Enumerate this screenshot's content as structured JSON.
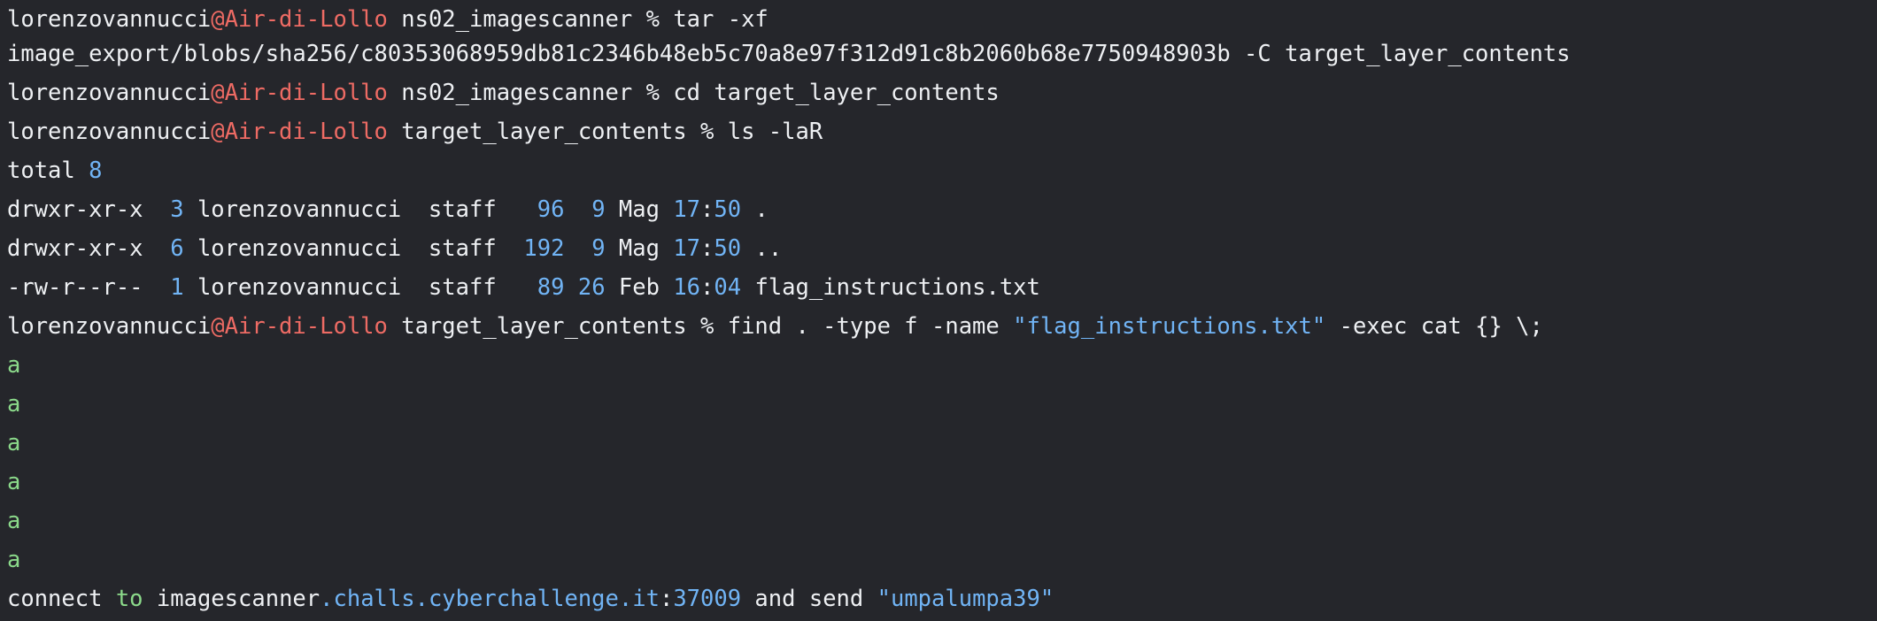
{
  "terminal": {
    "prompt1": {
      "user": "lorenzovannucci",
      "host": "@Air-di-Lollo",
      "dir": " ns02_imagescanner ",
      "sym": "% ",
      "cmd": "tar -xf"
    },
    "tar_args": "image_export/blobs/sha256/c80353068959db81c2346b48eb5c70a8e97f312d91c8b2060b68e7750948903b -C target_layer_contents",
    "prompt2": {
      "user": "lorenzovannucci",
      "host": "@Air-di-Lollo",
      "dir": " ns02_imagescanner ",
      "sym": "% ",
      "cmd": "cd target_layer_contents"
    },
    "prompt3": {
      "user": "lorenzovannucci",
      "host": "@Air-di-Lollo",
      "dir": " target_layer_contents ",
      "sym": "% ",
      "cmd": "ls -laR"
    },
    "total": {
      "label": "total ",
      "value": "8"
    },
    "listing": [
      {
        "perm": "drwxr-xr-x  ",
        "links": "3",
        "owner": " lorenzovannucci  staff   ",
        "size": "96",
        "sp1": "  ",
        "day": "9",
        "month": " Mag ",
        "hour": "17",
        "colon": ":",
        "min": "50",
        "name": " ."
      },
      {
        "perm": "drwxr-xr-x  ",
        "links": "6",
        "owner": " lorenzovannucci  staff  ",
        "size": "192",
        "sp1": "  ",
        "day": "9",
        "month": " Mag ",
        "hour": "17",
        "colon": ":",
        "min": "50",
        "name": " .."
      },
      {
        "perm": "-rw-r--r--  ",
        "links": "1",
        "owner": " lorenzovannucci  staff   ",
        "size": "89",
        "sp1": " ",
        "day": "26",
        "month": " Feb ",
        "hour": "16",
        "colon": ":",
        "min": "04",
        "name": " flag_instructions.txt"
      }
    ],
    "prompt4": {
      "user": "lorenzovannucci",
      "host": "@Air-di-Lollo",
      "dir": " target_layer_contents ",
      "sym": "% ",
      "cmd": "find . -type f -name ",
      "arg": "\"flag_instructions.txt\"",
      "rest": " -exec cat {} \\;"
    },
    "output_lines": [
      "a",
      "a",
      "a",
      "a",
      "a",
      "a"
    ],
    "final": {
      "p1": "connect ",
      "p2": "to",
      "p3": " imagescanner",
      "p4": ".challs.cyberchallenge.it",
      "p5": ":",
      "p6": "37009",
      "p7": " and send ",
      "p8": "\"umpalumpa39\""
    }
  }
}
